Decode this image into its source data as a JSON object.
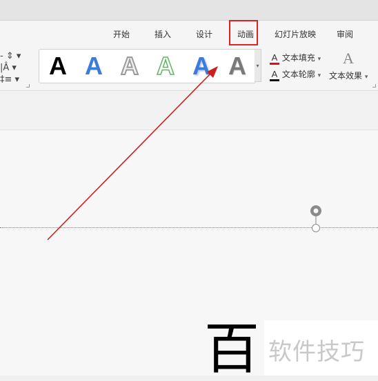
{
  "tabs": [
    "开始",
    "插入",
    "设计",
    "动画",
    "幻灯片放映",
    "审阅"
  ],
  "active_highlight_tab": "动画",
  "left_tools": {
    "row1": "- ⇕ ▾",
    "row2": "|Â ▾",
    "row3": "‡≡ ▾"
  },
  "wordart_styles": [
    {
      "glyph": "A",
      "style": "black-solid"
    },
    {
      "glyph": "A",
      "style": "blue-gradient"
    },
    {
      "glyph": "A",
      "style": "gray-outline"
    },
    {
      "glyph": "A",
      "style": "green-outline"
    },
    {
      "glyph": "A",
      "style": "blue-shadow"
    },
    {
      "glyph": "A",
      "style": "gray-gradient"
    }
  ],
  "format": {
    "fill_label": "文本填充",
    "outline_label": "文本轮廓",
    "effects_label": "文本效果",
    "fill_color": "#e01010",
    "outline_color": "#111111"
  },
  "slide": {
    "big_text": "百"
  },
  "watermark": "软件技巧",
  "annotation": {
    "color": "#d01c1c"
  }
}
